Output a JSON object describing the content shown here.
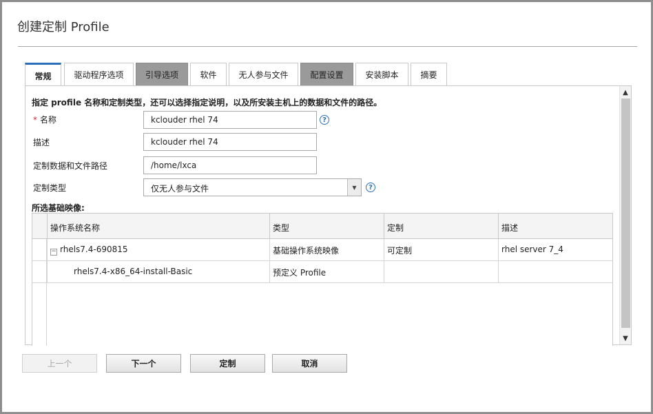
{
  "dialog": {
    "title": "创建定制 Profile"
  },
  "tabs": [
    {
      "label": "常规",
      "state": "active"
    },
    {
      "label": "驱动程序选项",
      "state": "normal"
    },
    {
      "label": "引导选项",
      "state": "gray"
    },
    {
      "label": "软件",
      "state": "normal"
    },
    {
      "label": "无人参与文件",
      "state": "normal"
    },
    {
      "label": "配置设置",
      "state": "gray"
    },
    {
      "label": "安装脚本",
      "state": "normal"
    },
    {
      "label": "摘要",
      "state": "normal"
    }
  ],
  "form": {
    "intro": "指定 profile 名称和定制类型，还可以选择指定说明，以及所安装主机上的数据和文件的路径。",
    "required_marker": "*",
    "name_label": "名称",
    "name_value": "kclouder rhel 74",
    "description_label": "描述",
    "description_value": "kclouder rhel 74",
    "path_label": "定制数据和文件路径",
    "path_value": "/home/lxca",
    "type_label": "定制类型",
    "type_value": "仅无人参与文件",
    "help_glyph": "?"
  },
  "base_image": {
    "section_title": "所选基础映像:",
    "columns": [
      "操作系统名称",
      "类型",
      "定制",
      "描述"
    ],
    "rows": [
      {
        "name": "rhels7.4-690815",
        "type": "基础操作系统映像",
        "custom": "可定制",
        "desc": "rhel server 7_4",
        "toggle": "−"
      },
      {
        "name": "rhels7.4-x86_64-install-Basic",
        "type": "预定义 Profile",
        "custom": "",
        "desc": ""
      }
    ]
  },
  "buttons": {
    "prev": "上一个",
    "next": "下一个",
    "customize": "定制",
    "cancel": "取消"
  },
  "icons": {
    "scroll_up": "scroll-up-arrow-icon",
    "scroll_down": "scroll-down-arrow-icon",
    "select_arrow": "chevron-down-icon",
    "help": "help-icon",
    "tree_toggle": "collapse-icon"
  },
  "colors": {
    "accent": "#2a6ebb",
    "required": "#c8302d",
    "gray_tab": "#9a9a9a"
  }
}
